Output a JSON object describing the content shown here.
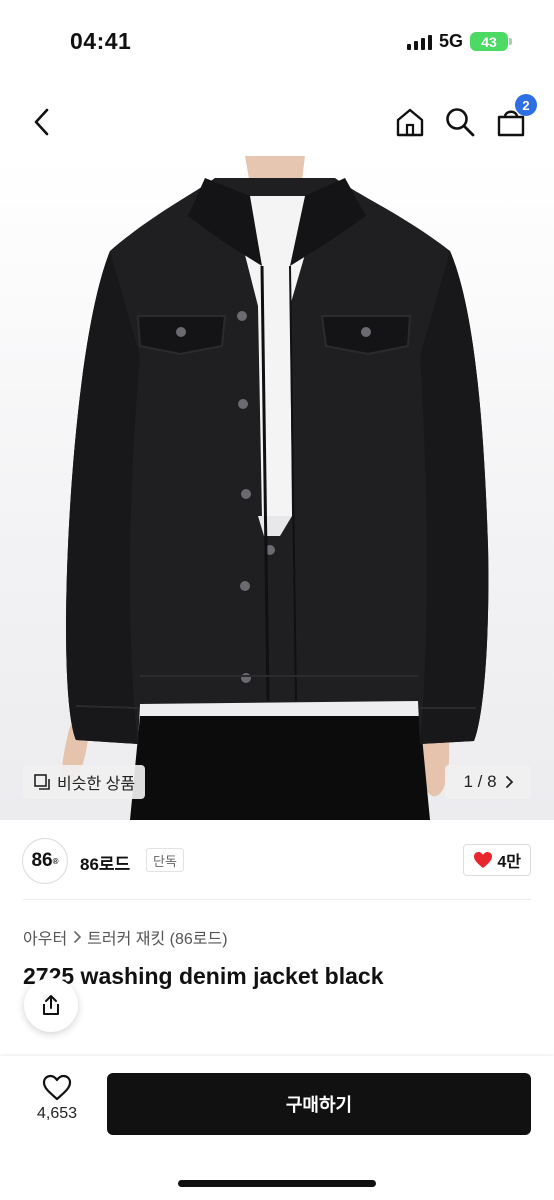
{
  "status_bar": {
    "time": "04:41",
    "network": "5G",
    "battery": "43"
  },
  "nav": {
    "icons": [
      "chevron-left-icon",
      "home-icon",
      "search-icon",
      "shopping-bag-icon"
    ],
    "cart_count": "2"
  },
  "gallery": {
    "similar_label": "비슷한 상품",
    "counter": "1 / 8"
  },
  "shop": {
    "logo_text": "86",
    "logo_mark": "®",
    "name": "86로드",
    "tag": "단독",
    "likes": "4만"
  },
  "breadcrumb": {
    "category": "아우터",
    "subcategory": "트러커 재킷 (86로드)"
  },
  "product": {
    "title": "2725 washing denim jacket black"
  },
  "bottom": {
    "wish_count": "4,653",
    "buy_label": "구매하기"
  },
  "colors": {
    "accent_blue": "#2f6fe4",
    "heart_red": "#e8262b",
    "buy_button": "#111111",
    "battery_green": "#4cd964"
  }
}
